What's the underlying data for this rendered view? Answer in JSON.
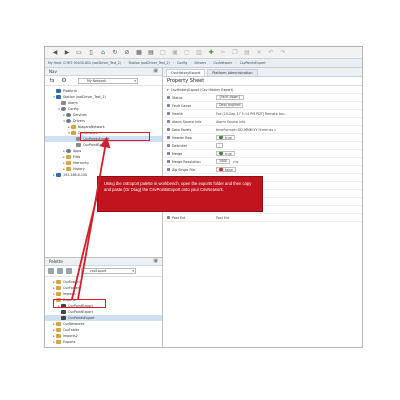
{
  "ord": [
    "My Host: COM7-90030-8GL (ootDriver_Test_2)",
    "Station (ootDriver_Test_2)",
    "Config",
    "Drivers",
    "CsvNetwork",
    "CsvPointsExport"
  ],
  "nav": {
    "title": "Nav",
    "network_select": "My Network",
    "tree": [
      {
        "label": "Platform",
        "indent": 1,
        "icon": "station"
      },
      {
        "label": "Station (ootDriver_Test_2)",
        "indent": 1,
        "icon": "station",
        "tw": "▾"
      },
      {
        "label": "Alarm",
        "indent": 2,
        "icon": "comp"
      },
      {
        "label": "Config",
        "indent": 2,
        "icon": "gear",
        "tw": "▾"
      },
      {
        "label": "Services",
        "indent": 3,
        "icon": "gear",
        "tw": "▸"
      },
      {
        "label": "Drivers",
        "indent": 3,
        "icon": "gear",
        "tw": "▾"
      },
      {
        "label": "NiagaraNetwork",
        "indent": 4,
        "icon": "folder",
        "tw": "▸"
      },
      {
        "label": "CsvNetwork",
        "indent": 4,
        "icon": "folder",
        "tw": "▾"
      },
      {
        "label": "CsvPointsExport",
        "indent": 5,
        "icon": "comp",
        "sel": true
      },
      {
        "label": "CsvPointExport",
        "indent": 5,
        "icon": "comp"
      },
      {
        "label": "Apps",
        "indent": 3,
        "icon": "gear",
        "tw": "▸"
      },
      {
        "label": "Files",
        "indent": 3,
        "icon": "folder",
        "tw": "▸"
      },
      {
        "label": "Hierarchy",
        "indent": 3,
        "icon": "folder",
        "tw": "▸"
      },
      {
        "label": "History",
        "indent": 3,
        "icon": "folder",
        "tw": "▸"
      },
      {
        "label": "192.168.8.150",
        "indent": 1,
        "icon": "station",
        "tw": "▸"
      }
    ]
  },
  "palette": {
    "title": "Palette",
    "select": "csvExport",
    "tree": [
      {
        "label": "CsvExport",
        "indent": 1,
        "icon": "folder",
        "tw": "▸"
      },
      {
        "label": "CsvFolder",
        "indent": 1,
        "icon": "folder",
        "tw": "▸"
      },
      {
        "label": "Imports",
        "indent": 1,
        "icon": "folder",
        "tw": "▸"
      },
      {
        "label": "Exports",
        "indent": 1,
        "icon": "folder",
        "tw": "▾"
      },
      {
        "label": "CsvPointExport",
        "indent": 2,
        "icon": "dark",
        "tw": "▸"
      },
      {
        "label": "CsvPointExport",
        "indent": 2,
        "icon": "dark"
      },
      {
        "label": "CsvPointsExport",
        "indent": 2,
        "icon": "dark",
        "sel": true
      },
      {
        "label": "CsvNetworks",
        "indent": 1,
        "icon": "folder",
        "tw": "▸"
      },
      {
        "label": "CsvFolder",
        "indent": 1,
        "icon": "folder",
        "tw": "▸"
      },
      {
        "label": "Imports2",
        "indent": 1,
        "icon": "folder",
        "tw": "▸"
      },
      {
        "label": "Exports",
        "indent": 1,
        "icon": "folder",
        "tw": "▸"
      }
    ]
  },
  "tabs": [
    "CsvHistoryExport",
    "Platform Administration"
  ],
  "property_sheet": {
    "title": "Property Sheet",
    "root": "CsvHistoryExport (Csv History Export)",
    "rows": [
      {
        "name": "Status",
        "value": "{fault,down}",
        "kind": "box"
      },
      {
        "name": "Fault Cause",
        "value": "Desc expired",
        "kind": "box"
      },
      {
        "name": "Health",
        "value": "Fail [19-Sep-17 5:14 PM PDT] Remote fau...",
        "kind": "text"
      },
      {
        "name": "Alarm Source Info",
        "value": "Alarm Source Info",
        "kind": "text"
      },
      {
        "name": "Data Facets",
        "value": "timeFormat=DD-MMM-YY H:mm:ss  »",
        "kind": "text"
      },
      {
        "name": "Header Row",
        "value": "true",
        "kind": "on"
      },
      {
        "name": "Delimiter",
        "value": ",",
        "kind": "box"
      },
      {
        "name": "Merge",
        "value": "true",
        "kind": "on"
      },
      {
        "name": "Merge Resolution",
        "value": "1000",
        "unit": "ms",
        "kind": "box"
      },
      {
        "name": "Zip Single File",
        "value": "false",
        "kind": "off"
      },
      {
        "name": "Email Export",
        "value": "Csv History Export Email",
        "kind": "text"
      },
      {
        "name": "Export File",
        "value": "Export File",
        "kind": "text"
      },
      {
        "name": "Export Ftp",
        "value": "Export Ftp",
        "kind": "text"
      },
      {
        "name": "Export Url",
        "value": "Export Url",
        "kind": "text"
      },
      {
        "name": "Export Servlet",
        "value": "Export Servlet",
        "kind": "text"
      },
      {
        "name": "Post Ext",
        "value": "Post Ext",
        "kind": "text"
      }
    ]
  },
  "callout": {
    "text": "Using the csExport palette in workbench, open the exports folder and then copy and paste (Or Drag) the CsvPointsExport onto your CsvNetwork."
  },
  "colors": {
    "callout_bg": "#c0151f",
    "highlight": "#d21f2b",
    "selection": "#cfe0f5"
  }
}
